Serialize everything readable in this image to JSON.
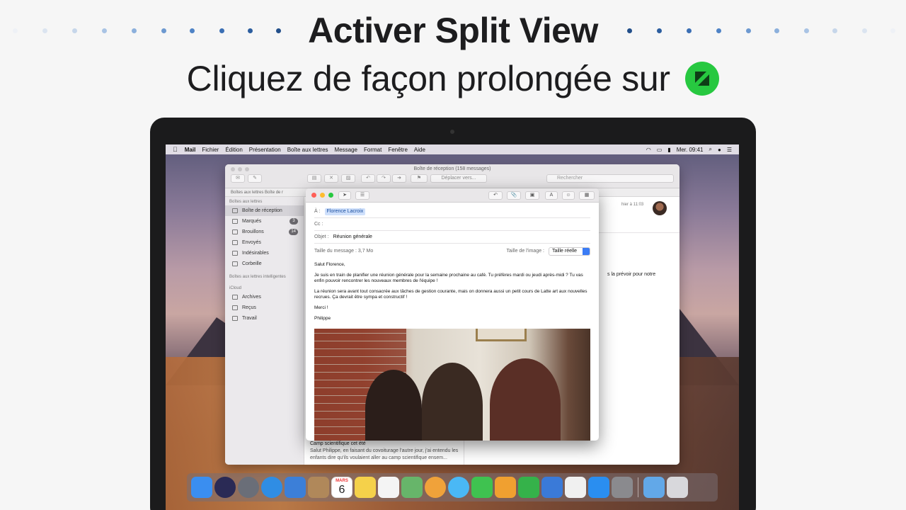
{
  "heading": {
    "title": "Activer Split View",
    "subtitle": "Cliquez de façon prolongée sur",
    "button_icon": "green-fullscreen-button-icon"
  },
  "menubar": {
    "apple_icon": "apple-logo-icon",
    "items": [
      "Mail",
      "Fichier",
      "Édition",
      "Présentation",
      "Boîte aux lettres",
      "Message",
      "Format",
      "Fenêtre",
      "Aide"
    ],
    "clock": "Mer. 09:41"
  },
  "mail": {
    "window_title": "Boîte de réception (158 messages)",
    "move_label": "Déplacer vers...",
    "search_placeholder": "Rechercher",
    "favorites": "Boîtes aux lettres    Boîte de r",
    "sidebar": {
      "section_mailboxes": "Boîtes aux lettres",
      "items": [
        {
          "label": "Boîte de réception",
          "badge": ""
        },
        {
          "label": "Marqués",
          "badge": "3"
        },
        {
          "label": "Brouillons",
          "badge": "14"
        },
        {
          "label": "Envoyés",
          "badge": ""
        },
        {
          "label": "Indésirables",
          "badge": ""
        },
        {
          "label": "Corbeille",
          "badge": ""
        }
      ],
      "section_smart": "Boîtes aux lettres intelligentes",
      "section_icloud": "iCloud",
      "icloud_items": [
        "Archives",
        "Reçus",
        "Travail"
      ]
    },
    "preview_message": {
      "subject": "Camp scientifique cet été",
      "snippet": "Salut Philippe, en faisant du covoiturage l'autre jour, j'ai entendu les enfants dire qu'ils voulaient aller au camp scientifique ensem..."
    },
    "viewer": {
      "date": "hier à 11:03",
      "snippet": "s la prévoir pour notre"
    }
  },
  "compose": {
    "to_label": "À :",
    "to_value": "Florence Lacroix",
    "cc_label": "Cc :",
    "subject_label": "Objet :",
    "subject_value": "Réunion générale",
    "message_size": "Taille du message : 3,7 Mo",
    "image_size_label": "Taille de l'image :",
    "image_size_value": "Taille réelle",
    "body": {
      "greeting": "Salut Florence,",
      "p1": "Je suis en train de planifier une réunion générale pour la semaine prochaine au café. Tu préfères mardi ou jeudi après-midi ? Tu vas enfin pouvoir rencontrer les nouveaux membres de l'équipe !",
      "p2": "La réunion sera avant tout consacrée aux tâches de gestion courante, mais on donnera aussi un petit cours de Latte art aux nouvelles recrues. Ça devrait être sympa et constructif !",
      "thanks": "Merci !",
      "signature": "Philippe"
    }
  },
  "dock": {
    "apps": [
      {
        "name": "finder-icon",
        "color": "#3a8ef0"
      },
      {
        "name": "siri-icon",
        "color": "#2a2a55"
      },
      {
        "name": "launchpad-icon",
        "color": "#6a6e78"
      },
      {
        "name": "safari-icon",
        "color": "#2f8de4"
      },
      {
        "name": "mail-icon",
        "color": "#3c7fd8"
      },
      {
        "name": "contacts-icon",
        "color": "#b0885a"
      },
      {
        "name": "calendar-icon",
        "color": "#ffffff"
      },
      {
        "name": "notes-icon",
        "color": "#f5d14a"
      },
      {
        "name": "reminders-icon",
        "color": "#f4f4f4"
      },
      {
        "name": "maps-icon",
        "color": "#67b56a"
      },
      {
        "name": "photos-icon",
        "color": "#f0a23a"
      },
      {
        "name": "messages-icon",
        "color": "#4ab8f5"
      },
      {
        "name": "facetime-icon",
        "color": "#3fc250"
      },
      {
        "name": "pages-icon",
        "color": "#f0a030"
      },
      {
        "name": "numbers-icon",
        "color": "#35b24a"
      },
      {
        "name": "keynote-icon",
        "color": "#3a7ad8"
      },
      {
        "name": "music-icon",
        "color": "#f0f0f0"
      },
      {
        "name": "app-store-icon",
        "color": "#2a8ef0"
      },
      {
        "name": "system-preferences-icon",
        "color": "#8a8a8e"
      }
    ],
    "folder": {
      "name": "downloads-folder-icon",
      "color": "#62a8e8"
    },
    "trash": {
      "name": "trash-icon",
      "color": "#d8d8dc"
    },
    "calendar_month": "MARS",
    "calendar_day": "6"
  }
}
